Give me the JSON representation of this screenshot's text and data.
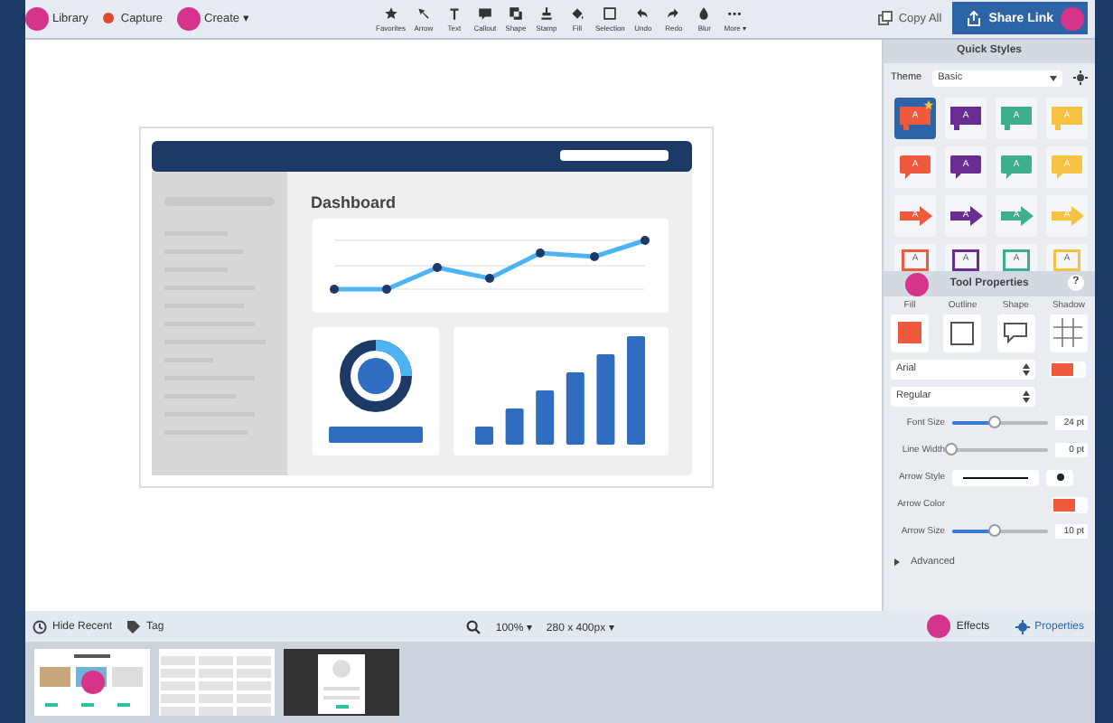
{
  "toolbar": {
    "left": [
      {
        "label": "Library",
        "kind": "library"
      },
      {
        "label": "Capture",
        "kind": "capture"
      },
      {
        "label": "Create ▾",
        "kind": "create"
      }
    ],
    "tools": [
      {
        "label": "Favorites"
      },
      {
        "label": "Arrow"
      },
      {
        "label": "Text"
      },
      {
        "label": "Callout"
      },
      {
        "label": "Shape"
      },
      {
        "label": "Stamp"
      },
      {
        "label": "Fill"
      },
      {
        "label": "Selection"
      },
      {
        "label": "Undo"
      },
      {
        "label": "Redo"
      },
      {
        "label": "Blur"
      },
      {
        "label": "More ▾"
      }
    ],
    "copy_all": "Copy All",
    "share_link": "Share Link"
  },
  "canvas": {
    "heading": "Dashboard"
  },
  "quick_styles": {
    "title": "Quick Styles",
    "theme_label": "Theme",
    "theme": "Basic",
    "styles": [
      {
        "kind": "callout-box",
        "color": "#ef5a3c",
        "label": "A",
        "selected": true
      },
      {
        "kind": "callout-box",
        "color": "#6a2d91",
        "label": "A",
        "selected": false
      },
      {
        "kind": "callout-box",
        "color": "#3fae8c",
        "label": "A",
        "selected": false
      },
      {
        "kind": "callout-box",
        "color": "#f5c242",
        "label": "A",
        "selected": false
      },
      {
        "kind": "callout",
        "color": "#ef5a3c",
        "label": "A",
        "selected": false
      },
      {
        "kind": "callout",
        "color": "#6a2d91",
        "label": "A",
        "selected": false
      },
      {
        "kind": "callout",
        "color": "#3fae8c",
        "label": "A",
        "selected": false
      },
      {
        "kind": "callout",
        "color": "#f5c242",
        "label": "A",
        "selected": false
      },
      {
        "kind": "arrow",
        "color": "#ef5a3c",
        "label": "A",
        "selected": false
      },
      {
        "kind": "arrow",
        "color": "#6a2d91",
        "label": "A",
        "selected": false
      },
      {
        "kind": "arrow",
        "color": "#3fae8c",
        "label": "A",
        "selected": false
      },
      {
        "kind": "arrow",
        "color": "#f5c242",
        "label": "A",
        "selected": false
      },
      {
        "kind": "frame",
        "color": "#ef5a3c",
        "label": "A",
        "selected": false
      },
      {
        "kind": "frame",
        "color": "#6a2d91",
        "label": "A",
        "selected": false
      },
      {
        "kind": "frame",
        "color": "#3fae8c",
        "label": "A",
        "selected": false
      },
      {
        "kind": "frame",
        "color": "#f5c242",
        "label": "A",
        "selected": false
      }
    ]
  },
  "tool_properties": {
    "title": "Tool Properties",
    "help": "?",
    "tabs": [
      {
        "label": "Fill",
        "kind": "fill"
      },
      {
        "label": "Outline",
        "kind": "outline"
      },
      {
        "label": "Shape",
        "kind": "shape"
      },
      {
        "label": "Shadow",
        "kind": "shadow"
      }
    ],
    "font": "Arial",
    "font_style": "Regular",
    "rows": [
      {
        "kind": "slider",
        "label": "Font Size",
        "level": 0.45,
        "reading": "24 pt"
      },
      {
        "kind": "slider",
        "label": "Line Width",
        "level": 0,
        "reading": "0 pt"
      },
      {
        "kind": "line-style",
        "label": "Arrow Style"
      },
      {
        "kind": "color",
        "label": "Arrow Color"
      },
      {
        "kind": "slider",
        "label": "Arrow Size",
        "level": 0.45,
        "reading": "10 pt"
      }
    ],
    "advanced": {
      "label": "Advanced",
      "expanded": false
    }
  },
  "bottom_bar": {
    "hide_recent": "Hide Recent",
    "tag": "Tag",
    "zoom": "100% ▾",
    "size": "280 x 400px ▾",
    "tabs": [
      {
        "label": "Effects",
        "kind": "effects",
        "selected": false
      },
      {
        "label": "Properties",
        "kind": "properties",
        "selected": true
      }
    ]
  },
  "tray": [
    {
      "kind": "gallery"
    },
    {
      "kind": "columns"
    },
    {
      "kind": "profile"
    }
  ]
}
